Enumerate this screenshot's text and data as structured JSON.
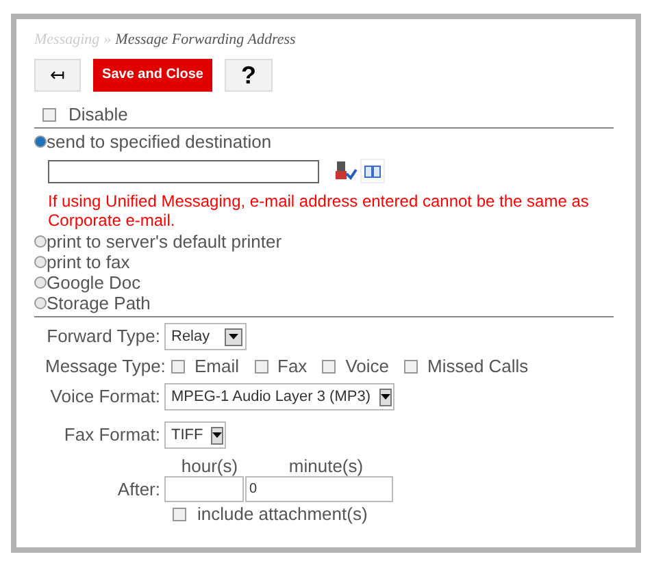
{
  "breadcrumb": {
    "parent": "Messaging",
    "separator": "»",
    "current": "Message Forwarding Address"
  },
  "toolbar": {
    "back": "↤",
    "save": "Save and Close",
    "help": "?"
  },
  "disable": {
    "label": "Disable",
    "checked": false
  },
  "destinations": [
    {
      "kind": "address",
      "label": "send to specified destination",
      "selected": true,
      "warning": "If using Unified Messaging, e-mail address entered cannot be the same as Corporate e-mail."
    },
    {
      "kind": "plain",
      "label": "print to server's default printer",
      "selected": false
    },
    {
      "kind": "plain",
      "label": "print to fax",
      "selected": false
    },
    {
      "kind": "plain",
      "label": "Google Doc",
      "selected": false
    },
    {
      "kind": "plain",
      "label": "Storage Path",
      "selected": false
    }
  ],
  "forward_type": {
    "label": "Forward Type:",
    "value": "Relay"
  },
  "message_type": {
    "label": "Message Type:",
    "options": [
      {
        "label": "Email",
        "checked": false
      },
      {
        "label": "Fax",
        "checked": false
      },
      {
        "label": "Voice",
        "checked": false
      },
      {
        "label": "Missed Calls",
        "checked": false
      }
    ]
  },
  "voice_format": {
    "label": "Voice Format:",
    "value": "MPEG-1 Audio Layer 3 (MP3)"
  },
  "fax_format": {
    "label": "Fax Format:",
    "value": "TIFF"
  },
  "after": {
    "label": "After:",
    "hours_label": "hour(s)",
    "minutes_label": "minute(s)",
    "minutes": "0"
  },
  "include_attachment": {
    "label": "include attachment(s)",
    "checked": false
  }
}
